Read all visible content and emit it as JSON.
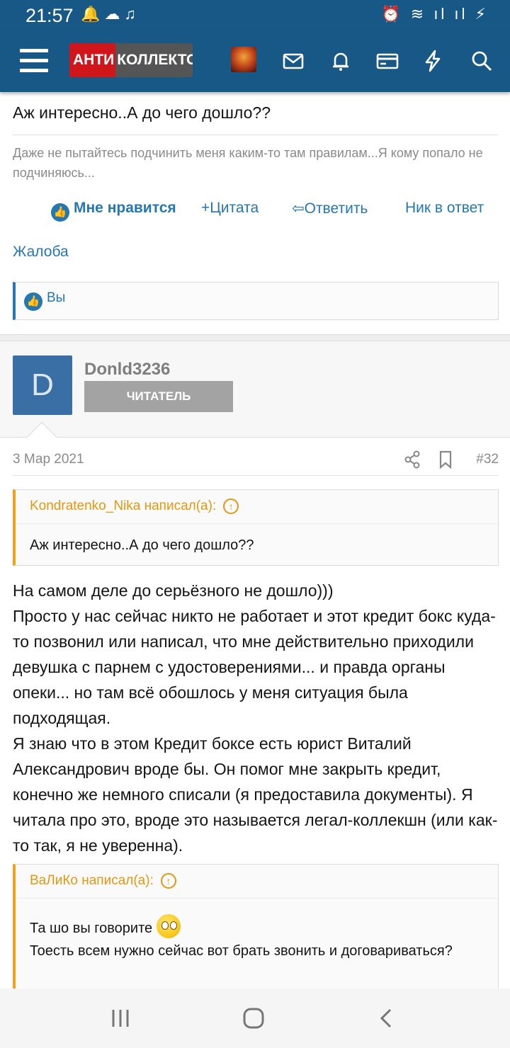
{
  "status_bar": {
    "time": "21:57",
    "left_icons": "🔔☁♫",
    "right_icons": "⏰ ≋ ıl ıl ⚡"
  },
  "app_bar": {
    "logo_part1": "АНТИ",
    "logo_part2": "КОЛЛЕКТОР"
  },
  "prev_post": {
    "text": "Аж интересно..А до чего дошло??",
    "signature": "Даже не пытайтесь подчинить меня каким-то там правилам...Я кому попало не подчиняюсь...",
    "actions": {
      "like": "Мне нравится",
      "quote": "+Цитата",
      "reply": "Ответить",
      "nick": "Ник в ответ"
    },
    "report": "Жалоба",
    "likes_by": "Вы"
  },
  "user": {
    "avatar_letter": "D",
    "name": "Donld3236",
    "role": "ЧИТАТЕЛЬ"
  },
  "post_meta": {
    "date": "3 Мар 2021",
    "number": "#32"
  },
  "quote1": {
    "author": "Kondratenko_Nika написал(а):",
    "text": "Аж интересно..А до чего дошло??"
  },
  "post_body": "На самом деле до серьёзного не дошло)))\nПросто у нас сейчас никто не работает и этот кредит бокс куда-то позвонил или написал, что мне действительно приходили девушка с парнем с удостоверениями... и правда органы опеки... но там всё обошлось у меня ситуация была подходящая.\nЯ знаю что в этом Кредит боксе есть юрист Виталий Александрович вроде бы. Он помог мне закрыть кредит, конечно же немного списали (я предоставила документы). Я читала про это, вроде это называется легал-коллекшн (или как-то так, я не уверенна).",
  "quote2": {
    "author": "ВаЛиКо написал(а):",
    "line1": "Та шо вы говорите",
    "line2": "Тоесть всем нужно сейчас вот брать звонить и договариваться?"
  },
  "colors": {
    "brand": "#185886",
    "link": "#2577b1",
    "quote_accent": "#f1a11a",
    "logo_red": "#d0161b"
  }
}
